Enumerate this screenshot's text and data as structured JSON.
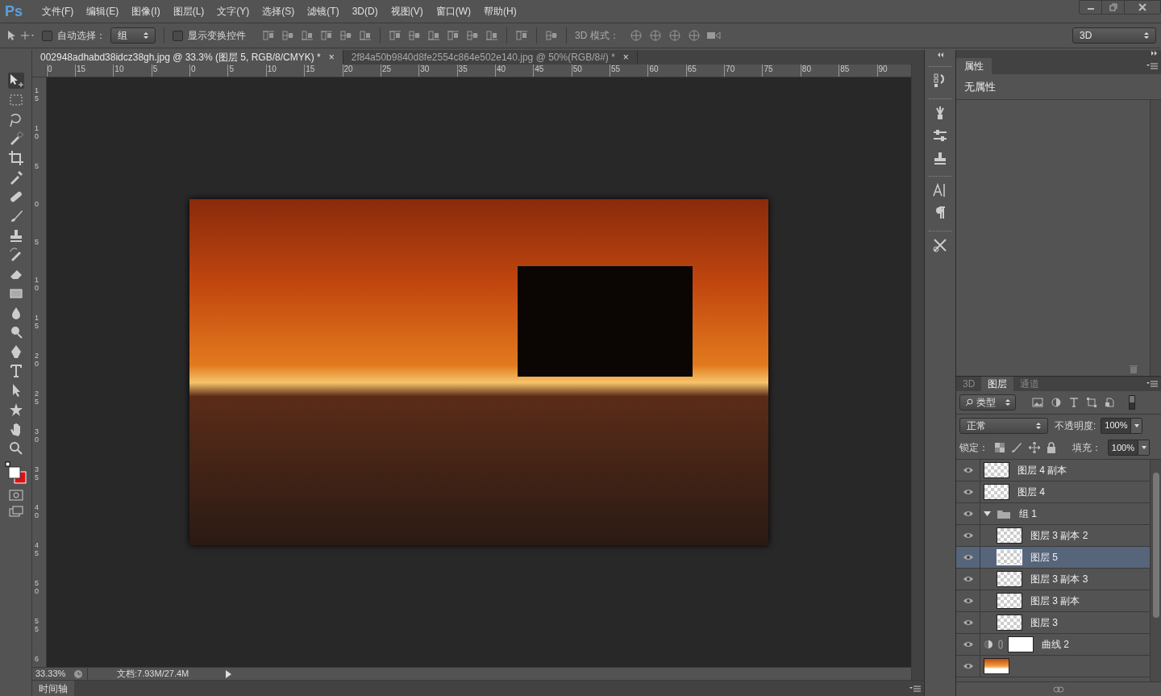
{
  "menu_bar": {
    "logo": "Ps",
    "items": [
      "文件(F)",
      "编辑(E)",
      "图像(I)",
      "图层(L)",
      "文字(Y)",
      "选择(S)",
      "滤镜(T)",
      "3D(D)",
      "视图(V)",
      "窗口(W)",
      "帮助(H)"
    ]
  },
  "options_bar": {
    "auto_select": {
      "label": "自动选择：",
      "checked": false
    },
    "auto_select_target": "组",
    "show_transform": {
      "label": "显示变换控件",
      "checked": false
    },
    "mode_label": "3D 模式：",
    "workspace": "3D"
  },
  "document_tabs": [
    {
      "title": "002948adhabd38idcz38gh.jpg @ 33.3% (图层 5, RGB/8/CMYK) *",
      "close": "×",
      "selected": true
    },
    {
      "title": "2f84a50b9840d8fe2554c864e502e140.jpg @ 50%(RGB/8#) *",
      "close": "×",
      "selected": false
    }
  ],
  "rulers": {
    "horizontal": [
      "0",
      "15",
      "10",
      "5",
      "0",
      "5",
      "10",
      "15",
      "20",
      "25",
      "30",
      "35",
      "40",
      "45",
      "50",
      "55",
      "60",
      "65",
      "70",
      "75",
      "80",
      "85",
      "90"
    ],
    "vertical": [
      "15",
      "10",
      "5",
      "0",
      "5",
      "10",
      "15",
      "20",
      "25",
      "30",
      "35",
      "40",
      "45",
      "50",
      "55",
      "6"
    ]
  },
  "status_bar": {
    "zoom": "33.33%",
    "doc_info": "文档:7.93M/27.4M"
  },
  "timeline_tab": "时间轴",
  "properties_panel": {
    "tabs": [
      {
        "label": "属性",
        "selected": true
      }
    ],
    "message": "无属性"
  },
  "layers_panel": {
    "tabs": [
      {
        "label": "3D",
        "selected": false
      },
      {
        "label": "图层",
        "selected": true
      },
      {
        "label": "通道",
        "selected": false
      }
    ],
    "filter": "类型",
    "blend_mode": "正常",
    "opacity_label": "不透明度:",
    "opacity": "100%",
    "lock_label": "锁定：",
    "fill_label": "填充：",
    "fill": "100%",
    "layers": [
      {
        "name": "图层 4 副本",
        "kind": "layer",
        "visible": true,
        "selected": false
      },
      {
        "name": "图层 4",
        "kind": "layer",
        "visible": true,
        "selected": false
      },
      {
        "name": "组 1",
        "kind": "group",
        "visible": true,
        "selected": false,
        "expanded": true,
        "children": [
          {
            "name": "图层 3 副本 2",
            "kind": "layer",
            "visible": true,
            "selected": false
          },
          {
            "name": "图层 5",
            "kind": "layer",
            "visible": true,
            "selected": true
          },
          {
            "name": "图层 3 副本 3",
            "kind": "layer",
            "visible": true,
            "selected": false
          },
          {
            "name": "图层 3 副本",
            "kind": "layer",
            "visible": true,
            "selected": false
          },
          {
            "name": "图层 3",
            "kind": "layer",
            "visible": true,
            "selected": false
          }
        ]
      },
      {
        "name": "曲线 2",
        "kind": "adjustment",
        "visible": true,
        "selected": false
      },
      {
        "kind": "image",
        "visible": true,
        "selected": false
      }
    ]
  }
}
